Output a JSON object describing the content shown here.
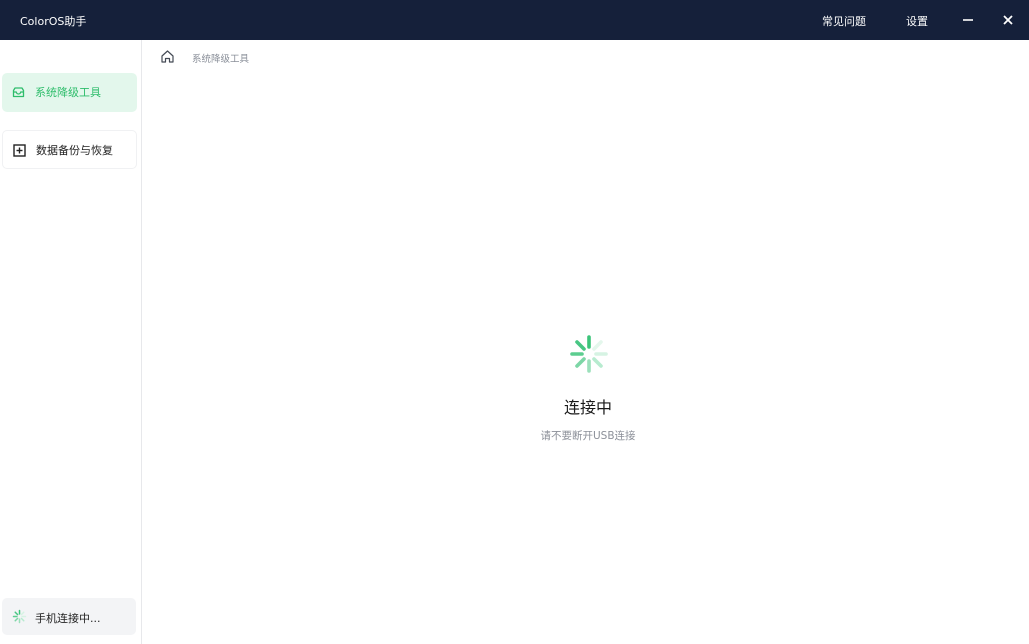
{
  "app": {
    "title": "ColorOS助手",
    "faq_label": "常见问题",
    "settings_label": "设置"
  },
  "sidebar": {
    "items": [
      {
        "label": "系统降级工具",
        "icon": "tray-icon",
        "active": true
      },
      {
        "label": "数据备份与恢复",
        "icon": "plus-box-icon",
        "active": false
      }
    ],
    "phone_status": "手机连接中..."
  },
  "breadcrumb": {
    "current": "系统降级工具"
  },
  "main": {
    "status_title": "连接中",
    "status_hint": "请不要断开USB连接"
  },
  "colors": {
    "titlebar": "#15203a",
    "accent": "#2ebd6b",
    "active_bg": "#e3f7ec"
  }
}
